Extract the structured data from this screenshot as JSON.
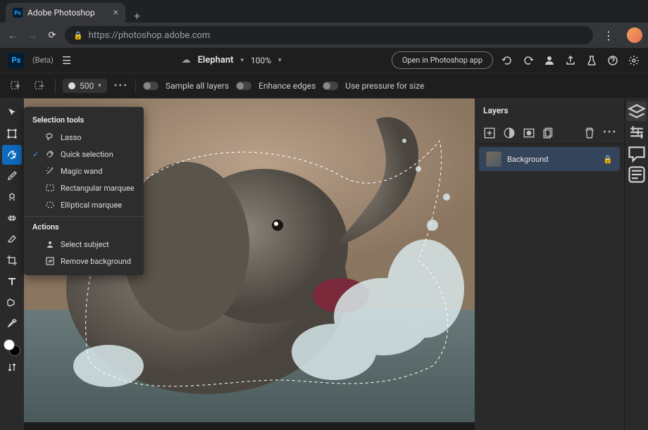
{
  "browser": {
    "tab_title": "Adobe Photoshop",
    "url": "https://photoshop.adobe.com"
  },
  "header": {
    "logo": "Ps",
    "beta_label": "(Beta)",
    "doc_name": "Elephant",
    "zoom": "100%",
    "open_app_label": "Open in Photoshop app"
  },
  "options": {
    "brush_size": "500",
    "sample_all_label": "Sample all layers",
    "enhance_edges_label": "Enhance edges",
    "use_pressure_label": "Use pressure for size"
  },
  "flyout": {
    "section1_title": "Selection tools",
    "items": [
      {
        "label": "Lasso",
        "checked": false
      },
      {
        "label": "Quick selection",
        "checked": true
      },
      {
        "label": "Magic wand",
        "checked": false
      },
      {
        "label": "Rectangular marquee",
        "checked": false
      },
      {
        "label": "Elliptical marquee",
        "checked": false
      }
    ],
    "section2_title": "Actions",
    "actions": [
      {
        "label": "Select subject"
      },
      {
        "label": "Remove background"
      }
    ]
  },
  "layers": {
    "panel_title": "Layers",
    "items": [
      {
        "name": "Background",
        "locked": true
      }
    ]
  }
}
